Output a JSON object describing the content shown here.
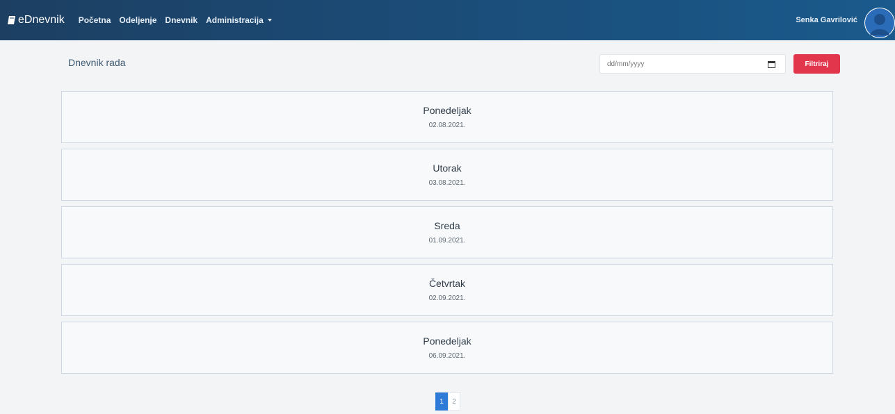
{
  "navbar": {
    "brand": "eDnevnik",
    "links": [
      "Početna",
      "Odeljenje",
      "Dnevnik",
      "Administracija"
    ],
    "user_name": "Senka Gavrilović",
    "bg_color": "#1b4b76",
    "brand_icon": "book-icon",
    "avatar_icon": "user-avatar-icon"
  },
  "header": {
    "title": "Dnevnik rada",
    "date_placeholder": "dd/mm/yyyy",
    "calendar_icon": "calendar-icon",
    "filter_label": "Filtriraj",
    "filter_color": "#e2364d"
  },
  "days": [
    {
      "name": "Ponedeljak",
      "date": "02.08.2021."
    },
    {
      "name": "Utorak",
      "date": "03.08.2021."
    },
    {
      "name": "Sreda",
      "date": "01.09.2021."
    },
    {
      "name": "Četvrtak",
      "date": "02.09.2021."
    },
    {
      "name": "Ponedeljak",
      "date": "06.09.2021."
    }
  ],
  "pagination": {
    "pages": [
      "1",
      "2"
    ],
    "active": "1",
    "active_color": "#2f7ad6"
  }
}
